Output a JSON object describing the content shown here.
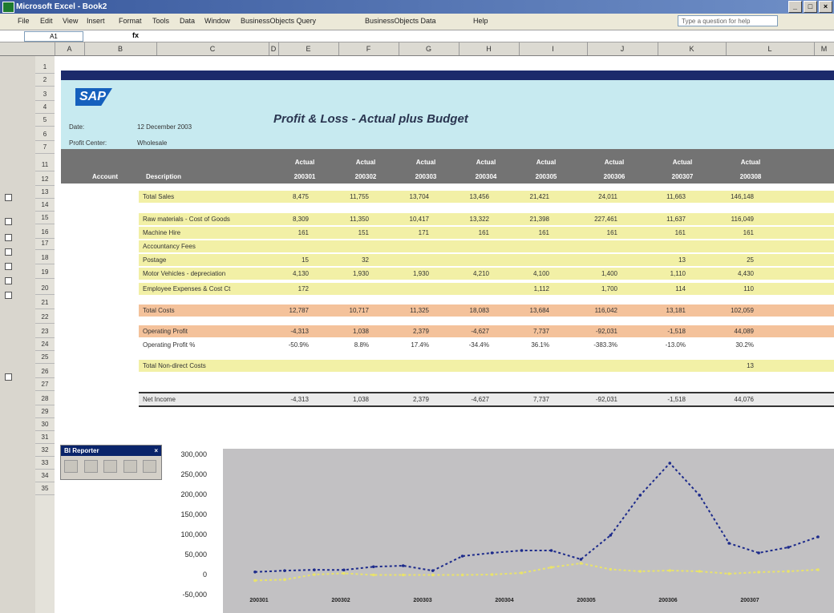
{
  "window": {
    "title": "Microsoft Excel - Book2",
    "controls": [
      "_",
      "□",
      "×"
    ]
  },
  "menubar": {
    "items": [
      "File",
      "Edit",
      "View",
      "Insert",
      "Format",
      "Tools",
      "Data",
      "Window",
      "BusinessObjects Query",
      "BusinessObjects Data",
      "Help"
    ],
    "help_placeholder": "Type a question for help"
  },
  "formula_bar": {
    "name_box": "A1",
    "fx": "fx"
  },
  "columns": [
    "A",
    "B",
    "C",
    "D",
    "E",
    "F",
    "G",
    "H",
    "I",
    "J",
    "K",
    "L",
    "M"
  ],
  "rows": [
    "1",
    "2",
    "3",
    "4",
    "5",
    "6",
    "7",
    "11",
    "12",
    "13",
    "14",
    "15",
    "16",
    "17",
    "18",
    "19",
    "20",
    "21",
    "22",
    "23",
    "24",
    "25",
    "26",
    "27",
    "28",
    "29",
    "30",
    "31",
    "32",
    "33",
    "34",
    "35"
  ],
  "report": {
    "logo": "SAP",
    "title": "Profit & Loss - Actual plus Budget",
    "date_label": "Date:",
    "date_value": "12 December 2003",
    "unit_label": "Profit Center:",
    "unit_value": "Wholesale",
    "hdr_left_1": "Account",
    "hdr_left_2": "Description",
    "period_headers": [
      {
        "line1": "Actual",
        "line2": "200301"
      },
      {
        "line1": "Actual",
        "line2": "200302"
      },
      {
        "line1": "Actual",
        "line2": "200303"
      },
      {
        "line1": "Actual",
        "line2": "200304"
      },
      {
        "line1": "Actual",
        "line2": "200305"
      },
      {
        "line1": "Actual",
        "line2": "200306"
      },
      {
        "line1": "Actual",
        "line2": "200307"
      },
      {
        "line1": "Actual",
        "line2": "200308"
      }
    ],
    "rows": [
      {
        "label": "Total Sales",
        "values": [
          "8,475",
          "11,755",
          "13,704",
          "13,456",
          "21,421",
          "24,011",
          "11,663",
          "146,148"
        ],
        "style": "yel"
      },
      {
        "label": "Raw materials - Cost of Goods",
        "values": [
          "8,309",
          "11,350",
          "10,417",
          "13,322",
          "21,398",
          "227,461",
          "11,637",
          "116,049"
        ],
        "style": "yel"
      },
      {
        "label": "Machine Hire",
        "values": [
          "161",
          "151",
          "171",
          "161",
          "161",
          "161",
          "161",
          "161"
        ],
        "style": "yel"
      },
      {
        "label": "Accountancy Fees",
        "values": [
          "",
          "",
          "",
          "",
          "",
          "",
          "",
          ""
        ],
        "style": "yel"
      },
      {
        "label": "Postage",
        "values": [
          "15",
          "32",
          "",
          "",
          "",
          "",
          "13",
          "25"
        ],
        "style": "yel"
      },
      {
        "label": "Motor Vehicles - depreciation",
        "values": [
          "4,130",
          "1,930",
          "1,930",
          "4,210",
          "4,100",
          "1,400",
          "1,110",
          "4,430"
        ],
        "style": "yel"
      },
      {
        "label": "Employee Expenses & Cost Ct",
        "values": [
          "172",
          "",
          "",
          "",
          "1,112",
          "1,700",
          "114",
          "110"
        ],
        "style": "yel"
      },
      {
        "label": "Total Costs",
        "values": [
          "12,787",
          "10,717",
          "11,325",
          "18,083",
          "13,684",
          "116,042",
          "13,181",
          "102,059"
        ],
        "style": "org"
      },
      {
        "label": "Operating Profit",
        "values": [
          "-4,313",
          "1,038",
          "2,379",
          "-4,627",
          "7,737",
          "-92,031",
          "-1,518",
          "44,089"
        ],
        "style": "org"
      },
      {
        "label": "Operating Profit %",
        "values": [
          "-50.9%",
          "8.8%",
          "17.4%",
          "-34.4%",
          "36.1%",
          "-383.3%",
          "-13.0%",
          "30.2%"
        ],
        "style": "plain"
      },
      {
        "label": "Total Non-direct Costs",
        "values": [
          "",
          "",
          "",
          "",
          "",
          "",
          "",
          "13"
        ],
        "style": "yel"
      },
      {
        "label": "Net Income",
        "values": [
          "-4,313",
          "1,038",
          "2,379",
          "-4,627",
          "7,737",
          "-92,031",
          "-1,518",
          "44,076"
        ],
        "style": "net"
      }
    ]
  },
  "toolbar_float": {
    "title": "BI Reporter",
    "close": "×"
  },
  "chart_data": {
    "type": "line",
    "categories": [
      "200301",
      "200302",
      "200303",
      "200304",
      "200305",
      "200306",
      "200307"
    ],
    "ylabels": [
      "300,000",
      "250,000",
      "200,000",
      "150,000",
      "100,000",
      "50,000",
      "0",
      "-50,000"
    ],
    "ylim": [
      -50000,
      300000
    ],
    "series": [
      {
        "name": "",
        "color": "#1c2a8b",
        "values": [
          8475,
          11755,
          13704,
          13456,
          21421,
          24011,
          11663,
          48000,
          56000,
          62000,
          62000,
          40000,
          100000,
          200000,
          280000,
          200000,
          80000,
          56000,
          70000,
          96000
        ]
      },
      {
        "name": "",
        "color": "#e9e36a",
        "values": [
          -12787,
          -10717,
          2000,
          5000,
          1000,
          1000,
          1000,
          1000,
          2000,
          6000,
          20000,
          30000,
          15000,
          10000,
          12000,
          10000,
          4000,
          8000,
          10000,
          14000
        ]
      }
    ]
  }
}
